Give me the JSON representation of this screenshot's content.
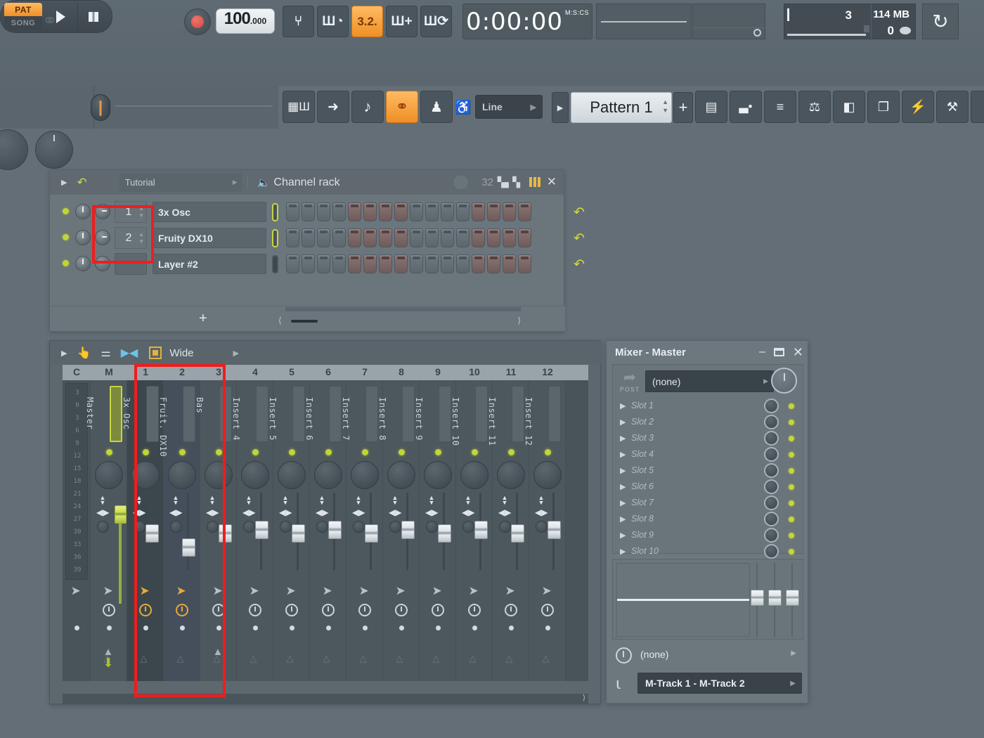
{
  "app": {
    "background_color": "#646e76"
  },
  "toolbar": {
    "transport": {
      "pat_label": "PAT",
      "song_label": "SONG",
      "play_icon": "play-icon",
      "stop_icon": "stop-icon",
      "record_icon": "record-icon"
    },
    "tempo": {
      "whole": "100",
      "fraction": ".000"
    },
    "mode_buttons": [
      {
        "name": "metronome",
        "glyph": "⑂",
        "active": false
      },
      {
        "name": "wait-for-input",
        "glyph": "Ш◔",
        "active": false
      },
      {
        "name": "count-in",
        "glyph": "3.2.",
        "active": true
      },
      {
        "name": "step-edit",
        "glyph": "Ш+",
        "active": false
      },
      {
        "name": "loop-record",
        "glyph": "Ш⟳",
        "active": false
      }
    ],
    "time": {
      "value": "0:00:00",
      "units": "M:S:CS"
    },
    "cpu": {
      "voices": "3",
      "memory": "114 MB",
      "cpu_pct": "0"
    },
    "reload_icon": "reload-icon",
    "row2_icons": [
      {
        "name": "playlist-icon",
        "glyph": "▦Ш",
        "active": false
      },
      {
        "name": "snap-icon",
        "glyph": "➜",
        "active": false
      },
      {
        "name": "note-icon",
        "glyph": "♪",
        "active": false
      },
      {
        "name": "link-icon",
        "glyph": "⚭",
        "active": true
      },
      {
        "name": "typing-keyboard-icon",
        "glyph": "♟",
        "active": false
      }
    ],
    "snap": {
      "label": "Line"
    },
    "pattern": {
      "label": "Pattern 1",
      "add_label": "+"
    },
    "right_icons": [
      {
        "name": "playlist-window-icon",
        "glyph": "▤"
      },
      {
        "name": "piano-roll-icon",
        "glyph": "▃•"
      },
      {
        "name": "channel-rack-icon",
        "glyph": "≡"
      },
      {
        "name": "mixer-icon",
        "glyph": "⚖"
      },
      {
        "name": "browser-icon",
        "glyph": "◧"
      },
      {
        "name": "clipboard-icon",
        "glyph": "❐"
      },
      {
        "name": "plugin-picker-icon",
        "glyph": "⚡"
      },
      {
        "name": "effects-icon",
        "glyph": "⚒"
      },
      {
        "name": "more-icon",
        "glyph": "❯"
      }
    ]
  },
  "channel_rack": {
    "title": "Channel rack",
    "preset_name": "Tutorial",
    "swing_value": "32",
    "undo_icon": "undo-icon",
    "close_icon": "close-icon",
    "add_label": "+",
    "channels": [
      {
        "number": "1",
        "name": "3x Osc",
        "armed": true,
        "steps": [
          "off",
          "off",
          "off",
          "off",
          "on",
          "on",
          "on",
          "on",
          "off",
          "off",
          "off",
          "off",
          "on",
          "on",
          "on",
          "on"
        ]
      },
      {
        "number": "2",
        "name": "Fruity DX10",
        "armed": true,
        "steps": [
          "off",
          "off",
          "off",
          "off",
          "on",
          "on",
          "on",
          "on",
          "off",
          "off",
          "off",
          "off",
          "on",
          "on",
          "on",
          "on"
        ]
      },
      {
        "number": "",
        "name": "Layer #2",
        "armed": false,
        "steps": [
          "off",
          "off",
          "off",
          "off",
          "on",
          "on",
          "on",
          "on",
          "off",
          "off",
          "off",
          "off",
          "on",
          "on",
          "on",
          "on"
        ]
      }
    ]
  },
  "mixer": {
    "view_label": "Wide",
    "ruler": [
      "C",
      "M",
      "1",
      "2",
      "3",
      "4",
      "5",
      "6",
      "7",
      "8",
      "9",
      "10",
      "11",
      "12"
    ],
    "scale_marks": [
      "3",
      "0",
      "3",
      "6",
      "9",
      "12",
      "15",
      "18",
      "21",
      "24",
      "27",
      "30",
      "33",
      "36",
      "39"
    ],
    "tracks": [
      {
        "index": "M",
        "name": "Master",
        "selected": false,
        "master": true
      },
      {
        "index": "1",
        "name": "3x Osc",
        "selected": true,
        "master": false
      },
      {
        "index": "2",
        "name": "Fruit. DX10",
        "selected": true,
        "master": false
      },
      {
        "index": "3",
        "name": "Bas",
        "selected": false,
        "master": false
      },
      {
        "index": "4",
        "name": "Insert 4",
        "selected": false,
        "master": false
      },
      {
        "index": "5",
        "name": "Insert 5",
        "selected": false,
        "master": false
      },
      {
        "index": "6",
        "name": "Insert 6",
        "selected": false,
        "master": false
      },
      {
        "index": "7",
        "name": "Insert 7",
        "selected": false,
        "master": false
      },
      {
        "index": "8",
        "name": "Insert 8",
        "selected": false,
        "master": false
      },
      {
        "index": "9",
        "name": "Insert 9",
        "selected": false,
        "master": false
      },
      {
        "index": "10",
        "name": "Insert 10",
        "selected": false,
        "master": false
      },
      {
        "index": "11",
        "name": "Insert 11",
        "selected": false,
        "master": false
      },
      {
        "index": "12",
        "name": "Insert 12",
        "selected": false,
        "master": false
      }
    ]
  },
  "mixer_master": {
    "title": "Mixer - Master",
    "minimize_icon": "minimize-icon",
    "maximize_icon": "maximize-icon",
    "close_icon": "close-icon",
    "post_label": "POST",
    "selected_effect": "(none)",
    "slots": [
      "Slot 1",
      "Slot 2",
      "Slot 3",
      "Slot 4",
      "Slot 5",
      "Slot 6",
      "Slot 7",
      "Slot 8",
      "Slot 9",
      "Slot 10"
    ],
    "sidechain": "(none)",
    "output": "M-Track 1 - M-Track 2"
  },
  "annotations": {
    "highlight_color": "#f01d1d",
    "rack_box_label": "channel-numbers-highlight",
    "mixer_box_label": "mixer-tracks-1-2-highlight"
  }
}
